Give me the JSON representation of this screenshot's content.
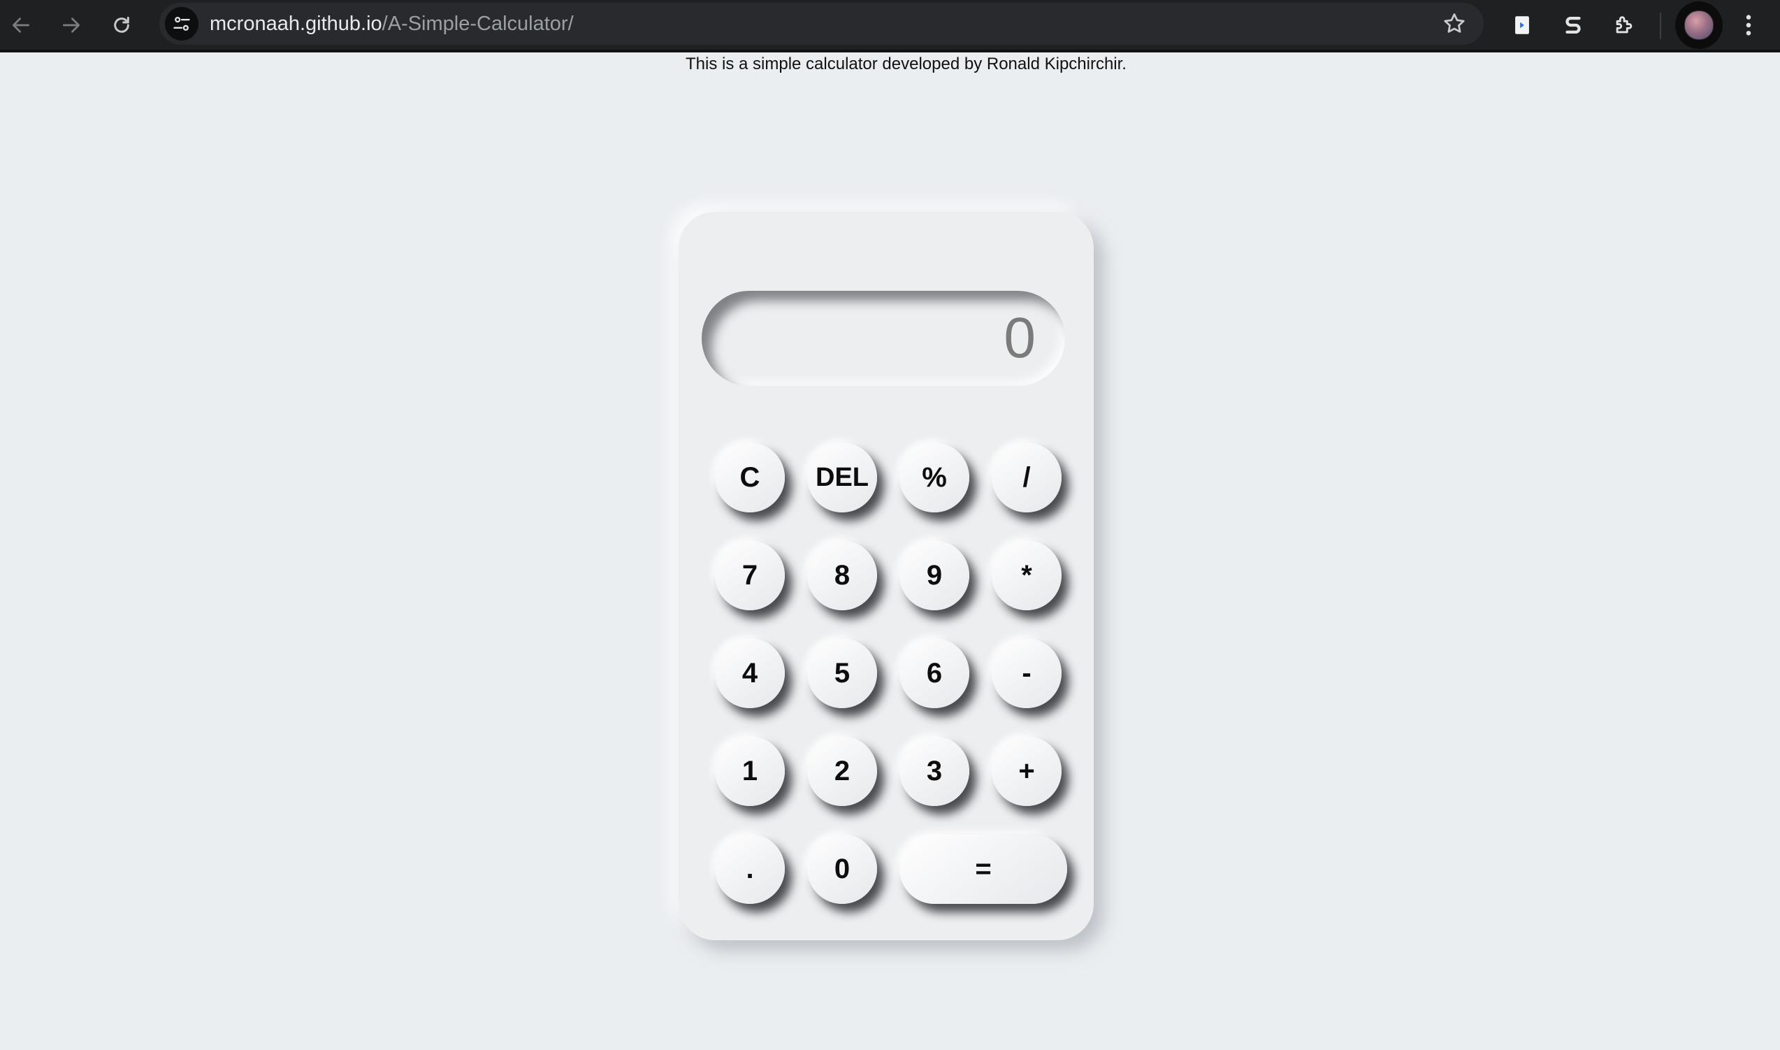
{
  "browser": {
    "url_host": "mcronaah.github.io",
    "url_path": "/A-Simple-Calculator/"
  },
  "page": {
    "credit": "This is a simple calculator developed by Ronald Kipchirchir."
  },
  "calculator": {
    "display": "0",
    "keys": {
      "clear": "C",
      "delete": "DEL",
      "percent": "%",
      "divide": "/",
      "seven": "7",
      "eight": "8",
      "nine": "9",
      "multiply": "*",
      "four": "4",
      "five": "5",
      "six": "6",
      "minus": "-",
      "one": "1",
      "two": "2",
      "three": "3",
      "plus": "+",
      "decimal": ".",
      "zero": "0",
      "equals": "="
    }
  },
  "colors": {
    "page_background": "#ebeef1",
    "toolbar_background": "#1f2022",
    "display_text": "#7b7b7b"
  }
}
